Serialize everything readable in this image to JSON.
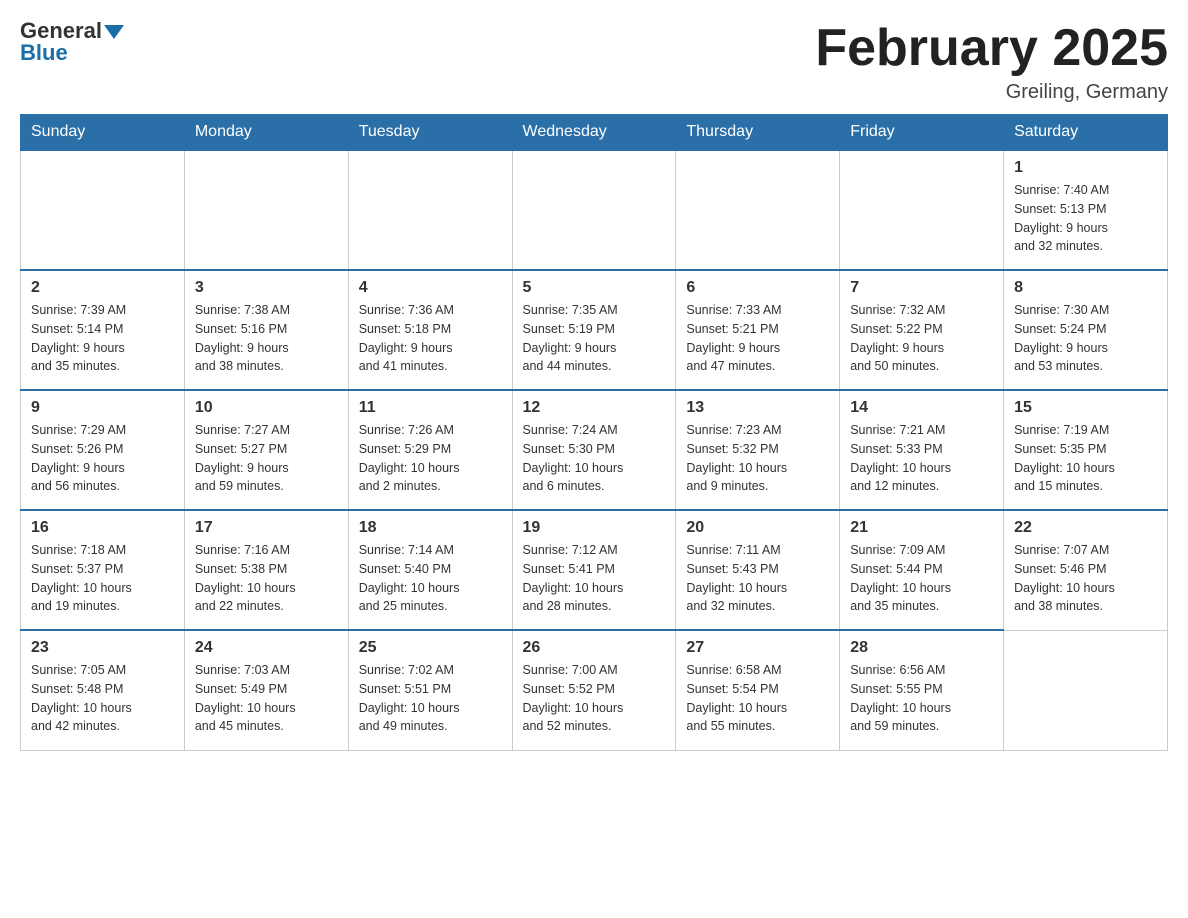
{
  "header": {
    "logo_general": "General",
    "logo_blue": "Blue",
    "month_title": "February 2025",
    "location": "Greiling, Germany"
  },
  "weekdays": [
    "Sunday",
    "Monday",
    "Tuesday",
    "Wednesday",
    "Thursday",
    "Friday",
    "Saturday"
  ],
  "weeks": [
    [
      {
        "day": "",
        "info": ""
      },
      {
        "day": "",
        "info": ""
      },
      {
        "day": "",
        "info": ""
      },
      {
        "day": "",
        "info": ""
      },
      {
        "day": "",
        "info": ""
      },
      {
        "day": "",
        "info": ""
      },
      {
        "day": "1",
        "info": "Sunrise: 7:40 AM\nSunset: 5:13 PM\nDaylight: 9 hours\nand 32 minutes."
      }
    ],
    [
      {
        "day": "2",
        "info": "Sunrise: 7:39 AM\nSunset: 5:14 PM\nDaylight: 9 hours\nand 35 minutes."
      },
      {
        "day": "3",
        "info": "Sunrise: 7:38 AM\nSunset: 5:16 PM\nDaylight: 9 hours\nand 38 minutes."
      },
      {
        "day": "4",
        "info": "Sunrise: 7:36 AM\nSunset: 5:18 PM\nDaylight: 9 hours\nand 41 minutes."
      },
      {
        "day": "5",
        "info": "Sunrise: 7:35 AM\nSunset: 5:19 PM\nDaylight: 9 hours\nand 44 minutes."
      },
      {
        "day": "6",
        "info": "Sunrise: 7:33 AM\nSunset: 5:21 PM\nDaylight: 9 hours\nand 47 minutes."
      },
      {
        "day": "7",
        "info": "Sunrise: 7:32 AM\nSunset: 5:22 PM\nDaylight: 9 hours\nand 50 minutes."
      },
      {
        "day": "8",
        "info": "Sunrise: 7:30 AM\nSunset: 5:24 PM\nDaylight: 9 hours\nand 53 minutes."
      }
    ],
    [
      {
        "day": "9",
        "info": "Sunrise: 7:29 AM\nSunset: 5:26 PM\nDaylight: 9 hours\nand 56 minutes."
      },
      {
        "day": "10",
        "info": "Sunrise: 7:27 AM\nSunset: 5:27 PM\nDaylight: 9 hours\nand 59 minutes."
      },
      {
        "day": "11",
        "info": "Sunrise: 7:26 AM\nSunset: 5:29 PM\nDaylight: 10 hours\nand 2 minutes."
      },
      {
        "day": "12",
        "info": "Sunrise: 7:24 AM\nSunset: 5:30 PM\nDaylight: 10 hours\nand 6 minutes."
      },
      {
        "day": "13",
        "info": "Sunrise: 7:23 AM\nSunset: 5:32 PM\nDaylight: 10 hours\nand 9 minutes."
      },
      {
        "day": "14",
        "info": "Sunrise: 7:21 AM\nSunset: 5:33 PM\nDaylight: 10 hours\nand 12 minutes."
      },
      {
        "day": "15",
        "info": "Sunrise: 7:19 AM\nSunset: 5:35 PM\nDaylight: 10 hours\nand 15 minutes."
      }
    ],
    [
      {
        "day": "16",
        "info": "Sunrise: 7:18 AM\nSunset: 5:37 PM\nDaylight: 10 hours\nand 19 minutes."
      },
      {
        "day": "17",
        "info": "Sunrise: 7:16 AM\nSunset: 5:38 PM\nDaylight: 10 hours\nand 22 minutes."
      },
      {
        "day": "18",
        "info": "Sunrise: 7:14 AM\nSunset: 5:40 PM\nDaylight: 10 hours\nand 25 minutes."
      },
      {
        "day": "19",
        "info": "Sunrise: 7:12 AM\nSunset: 5:41 PM\nDaylight: 10 hours\nand 28 minutes."
      },
      {
        "day": "20",
        "info": "Sunrise: 7:11 AM\nSunset: 5:43 PM\nDaylight: 10 hours\nand 32 minutes."
      },
      {
        "day": "21",
        "info": "Sunrise: 7:09 AM\nSunset: 5:44 PM\nDaylight: 10 hours\nand 35 minutes."
      },
      {
        "day": "22",
        "info": "Sunrise: 7:07 AM\nSunset: 5:46 PM\nDaylight: 10 hours\nand 38 minutes."
      }
    ],
    [
      {
        "day": "23",
        "info": "Sunrise: 7:05 AM\nSunset: 5:48 PM\nDaylight: 10 hours\nand 42 minutes."
      },
      {
        "day": "24",
        "info": "Sunrise: 7:03 AM\nSunset: 5:49 PM\nDaylight: 10 hours\nand 45 minutes."
      },
      {
        "day": "25",
        "info": "Sunrise: 7:02 AM\nSunset: 5:51 PM\nDaylight: 10 hours\nand 49 minutes."
      },
      {
        "day": "26",
        "info": "Sunrise: 7:00 AM\nSunset: 5:52 PM\nDaylight: 10 hours\nand 52 minutes."
      },
      {
        "day": "27",
        "info": "Sunrise: 6:58 AM\nSunset: 5:54 PM\nDaylight: 10 hours\nand 55 minutes."
      },
      {
        "day": "28",
        "info": "Sunrise: 6:56 AM\nSunset: 5:55 PM\nDaylight: 10 hours\nand 59 minutes."
      },
      {
        "day": "",
        "info": ""
      }
    ]
  ]
}
